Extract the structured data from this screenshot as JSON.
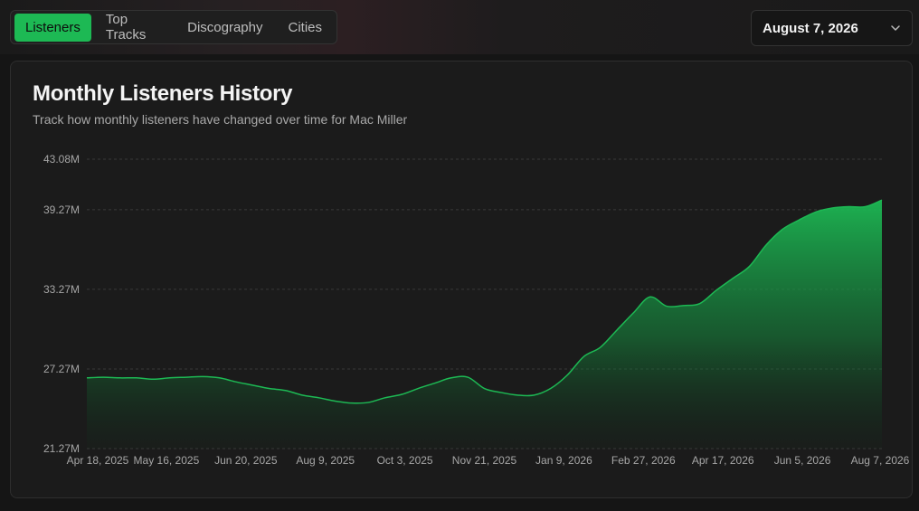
{
  "tabs": [
    {
      "label": "Listeners",
      "active": true
    },
    {
      "label": "Top Tracks",
      "active": false
    },
    {
      "label": "Discography",
      "active": false
    },
    {
      "label": "Cities",
      "active": false
    }
  ],
  "date_select": {
    "value": "August 7, 2026",
    "icon": "chevron-down-icon"
  },
  "card": {
    "title": "Monthly Listeners History",
    "subtitle": "Track how monthly listeners have changed over time for Mac Miller"
  },
  "colors": {
    "accent": "#1db954",
    "background": "#151515",
    "card": "#1b1b1b"
  },
  "chart_data": {
    "type": "area",
    "title": "Monthly Listeners History",
    "xlabel": "",
    "ylabel": "",
    "ylim": [
      21.27,
      43.08
    ],
    "yticks": [
      "21.27M",
      "27.27M",
      "33.27M",
      "39.27M",
      "43.08M"
    ],
    "ytick_values": [
      21.27,
      27.27,
      33.27,
      39.27,
      43.08
    ],
    "xticks": [
      "Apr 18, 2025",
      "May 16, 2025",
      "Jun 20, 2025",
      "Aug 9, 2025",
      "Oct 3, 2025",
      "Nov 21, 2025",
      "Jan 9, 2026",
      "Feb 27, 2026",
      "Apr 17, 2026",
      "Jun 5, 2026",
      "Aug 7, 2026"
    ],
    "grid": true,
    "series": [
      {
        "values": [
          26.6,
          26.65,
          26.6,
          26.6,
          26.5,
          26.6,
          26.65,
          26.7,
          26.6,
          26.3,
          26.05,
          25.8,
          25.65,
          25.3,
          25.1,
          24.85,
          24.7,
          24.75,
          25.1,
          25.35,
          25.8,
          26.2,
          26.6,
          26.65,
          25.8,
          25.5,
          25.3,
          25.3,
          25.8,
          26.8,
          28.2,
          28.9,
          30.2,
          31.5,
          32.7,
          32.0,
          32.05,
          32.2,
          33.2,
          34.1,
          35.0,
          36.6,
          37.8,
          38.5,
          39.1,
          39.4,
          39.5,
          39.5,
          40.0
        ]
      }
    ]
  }
}
